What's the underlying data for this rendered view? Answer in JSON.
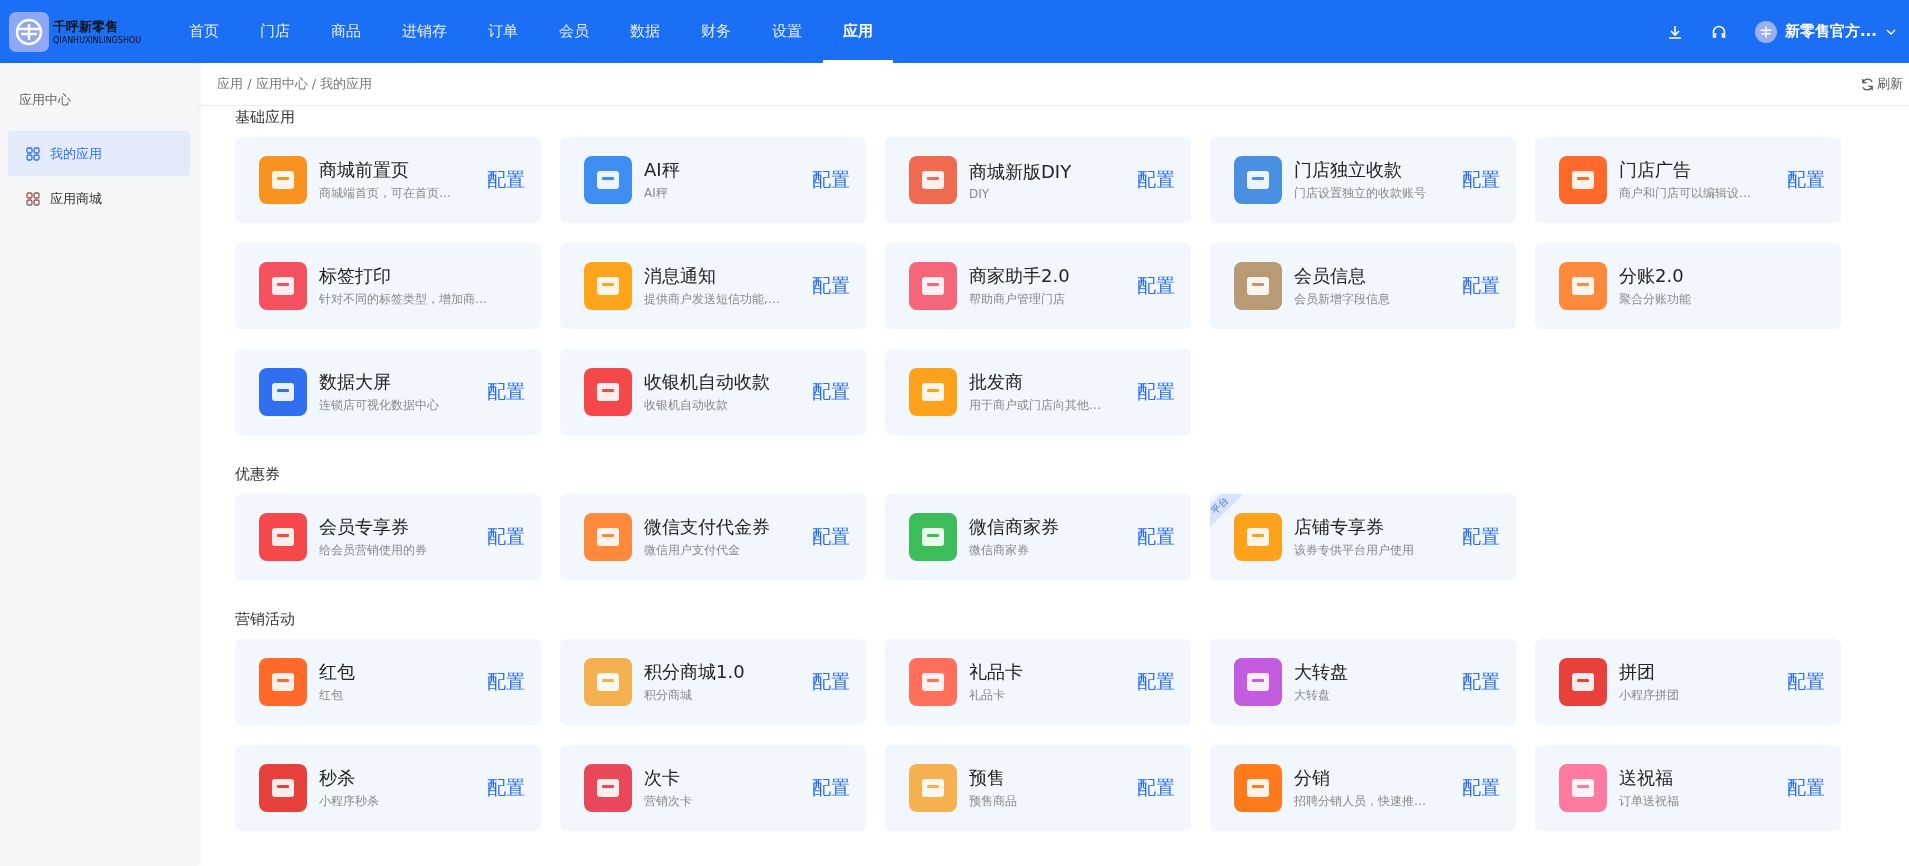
{
  "brand": {
    "name": "千呼新零售",
    "pinyin": "QIANHUXINLINGSHOU"
  },
  "nav": [
    {
      "label": "首页",
      "selected": false
    },
    {
      "label": "门店",
      "selected": false
    },
    {
      "label": "商品",
      "selected": false
    },
    {
      "label": "进销存",
      "selected": false
    },
    {
      "label": "订单",
      "selected": false
    },
    {
      "label": "会员",
      "selected": false
    },
    {
      "label": "数据",
      "selected": false
    },
    {
      "label": "财务",
      "selected": false
    },
    {
      "label": "设置",
      "selected": false
    },
    {
      "label": "应用",
      "selected": true
    }
  ],
  "account": {
    "name": "新零售官方..."
  },
  "sidebar": {
    "title": "应用中心",
    "items": [
      {
        "label": "我的应用",
        "selected": true
      },
      {
        "label": "应用商城",
        "selected": false
      }
    ]
  },
  "breadcrumb": "应用 / 应用中心 / 我的应用",
  "refresh": "刷新",
  "sections": [
    {
      "title": "基础应用",
      "apps": [
        {
          "name": "商城前置页",
          "desc": "商城端首页，可在首页…",
          "action": "配置"
        },
        {
          "name": "AI秤",
          "desc": "AI秤",
          "action": "配置"
        },
        {
          "name": "商城新版DIY",
          "desc": "DIY",
          "action": "配置"
        },
        {
          "name": "门店独立收款",
          "desc": "门店设置独立的收款账号",
          "action": "配置"
        },
        {
          "name": "门店广告",
          "desc": "商户和门店可以编辑设…",
          "action": "配置"
        },
        {
          "name": "标签打印",
          "desc": "针对不同的标签类型，增加商…"
        },
        {
          "name": "消息通知",
          "desc": "提供商户发送短信功能,…",
          "action": "配置"
        },
        {
          "name": "商家助手2.0",
          "desc": "帮助商户管理门店",
          "action": "配置"
        },
        {
          "name": "会员信息",
          "desc": "会员新增字段信息",
          "action": "配置"
        },
        {
          "name": "分账2.0",
          "desc": "聚合分账功能"
        },
        {
          "name": "数据大屏",
          "desc": "连锁店可视化数据中心",
          "action": "配置"
        },
        {
          "name": "收银机自动收款",
          "desc": "收银机自动收款",
          "action": "配置"
        },
        {
          "name": "批发商",
          "desc": "用于商户或门店向其他…",
          "action": "配置"
        }
      ]
    },
    {
      "title": "优惠券",
      "apps": [
        {
          "name": "会员专享券",
          "desc": "给会员营销使用的券",
          "action": "配置"
        },
        {
          "name": "微信支付代金券",
          "desc": "微信用户支付代金",
          "action": "配置"
        },
        {
          "name": "微信商家券",
          "desc": "微信商家券",
          "action": "配置"
        },
        {
          "name": "店铺专享券",
          "desc": "该券专供平台用户使用",
          "action": "配置",
          "badge": "平台"
        }
      ]
    },
    {
      "title": "营销活动",
      "apps": [
        {
          "name": "红包",
          "desc": "红包",
          "action": "配置"
        },
        {
          "name": "积分商城1.0",
          "desc": "积分商城",
          "action": "配置"
        },
        {
          "name": "礼品卡",
          "desc": "礼品卡",
          "action": "配置"
        },
        {
          "name": "大转盘",
          "desc": "大转盘",
          "action": "配置"
        },
        {
          "name": "拼团",
          "desc": "小程序拼团",
          "action": "配置"
        },
        {
          "name": "秒杀",
          "desc": "小程序秒杀",
          "action": "配置"
        },
        {
          "name": "次卡",
          "desc": "营销次卡",
          "action": "配置"
        },
        {
          "name": "预售",
          "desc": "预售商品",
          "action": "配置"
        },
        {
          "name": "分销",
          "desc": "招聘分销人员，快速推…",
          "action": "配置"
        },
        {
          "name": "送祝福",
          "desc": "订单送祝福",
          "action": "配置"
        }
      ]
    }
  ]
}
